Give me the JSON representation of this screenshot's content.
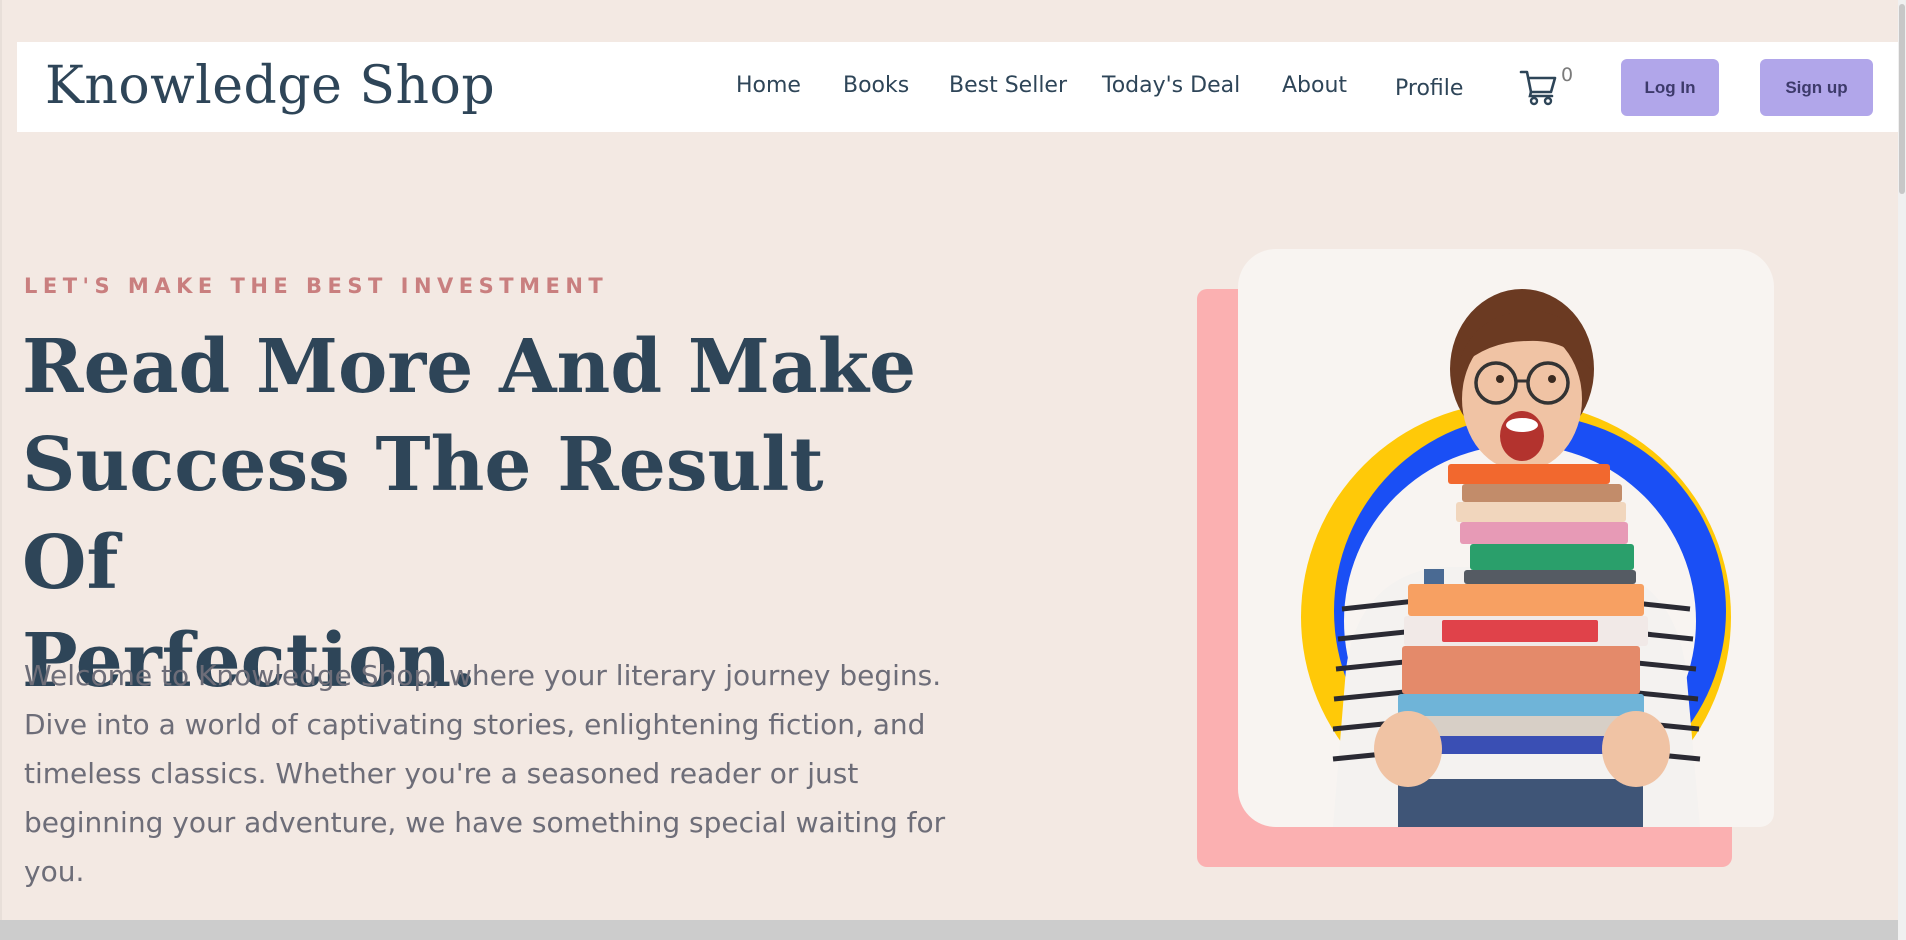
{
  "navbar": {
    "logo": "Knowledge Shop",
    "links": [
      "Home",
      "Books",
      "Best Seller",
      "Today's Deal",
      "About",
      "Profile"
    ],
    "cart_count": "0",
    "login_label": "Log In",
    "signup_label": "Sign up"
  },
  "hero": {
    "eyebrow": "LET'S MAKE THE BEST INVESTMENT",
    "headline_lines": [
      "Read More And Make",
      "Success The Result Of",
      "Perfection."
    ],
    "intro": "Welcome to Knowledge Shop, where your literary journey begins. Dive into a world of captivating stories, enlightening fiction, and timeless classics. Whether you're a seasoned reader or just beginning your adventure, we have something special waiting for you."
  },
  "colors": {
    "background": "#f3e9e3",
    "text_dark": "#2e4558",
    "eyebrow": "#c97f7f",
    "button": "#b1a6ea",
    "card_back": "#fbb0b1"
  },
  "icons": {
    "cart": "shopping-cart-icon"
  }
}
